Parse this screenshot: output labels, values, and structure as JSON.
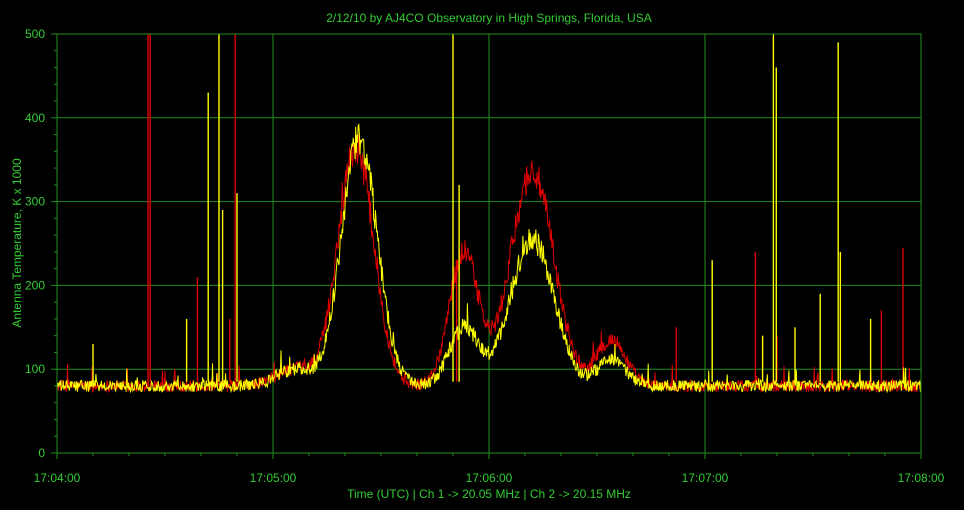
{
  "chart_data": {
    "type": "line",
    "title": "2/12/10  by  AJ4CO Observatory  in  High Springs, Florida, USA",
    "xlabel": "Time (UTC)  |  Ch 1 -> 20.05 MHz  |  Ch 2 -> 20.15 MHz",
    "ylabel": "Antenna Temperature, K x 1000",
    "xlim_seconds": [
      0,
      240
    ],
    "x_tick_labels": [
      "17:04:00",
      "17:05:00",
      "17:06:00",
      "17:07:00",
      "17:08:00"
    ],
    "ylim": [
      0,
      500
    ],
    "y_tick_labels": [
      "0",
      "100",
      "200",
      "300",
      "400",
      "500"
    ],
    "grid": true,
    "baseline": 80,
    "series": [
      {
        "color": "#dd0000",
        "bursts": [
          {
            "center": 83,
            "width": 5,
            "peak": 285
          },
          {
            "center": 113,
            "width": 4,
            "peak": 160
          },
          {
            "center": 132,
            "width": 6,
            "peak": 255
          },
          {
            "center": 154,
            "width": 4,
            "peak": 55
          }
        ],
        "spikes": [
          {
            "t": 25.3,
            "value": 500
          },
          {
            "t": 25.9,
            "value": 500
          },
          {
            "t": 49.5,
            "value": 500
          },
          {
            "t": 39,
            "value": 210
          },
          {
            "t": 48,
            "value": 160
          },
          {
            "t": 111,
            "value": 230
          },
          {
            "t": 172,
            "value": 150
          },
          {
            "t": 194,
            "value": 240
          },
          {
            "t": 200,
            "value": 140
          },
          {
            "t": 229,
            "value": 170
          },
          {
            "t": 235,
            "value": 245
          }
        ]
      },
      {
        "color": "#ffff00",
        "bursts": [
          {
            "center": 84,
            "width": 5,
            "peak": 295
          },
          {
            "center": 113,
            "width": 4,
            "peak": 70
          },
          {
            "center": 132,
            "width": 6,
            "peak": 175
          },
          {
            "center": 154,
            "width": 4,
            "peak": 30
          }
        ],
        "spikes": [
          {
            "t": 10,
            "value": 130
          },
          {
            "t": 36,
            "value": 160
          },
          {
            "t": 42,
            "value": 430
          },
          {
            "t": 45,
            "value": 500
          },
          {
            "t": 46,
            "value": 290
          },
          {
            "t": 50,
            "value": 310
          },
          {
            "t": 110,
            "value": 500
          },
          {
            "t": 111.7,
            "value": 320
          },
          {
            "t": 182,
            "value": 230
          },
          {
            "t": 196,
            "value": 140
          },
          {
            "t": 199,
            "value": 500
          },
          {
            "t": 199.8,
            "value": 460
          },
          {
            "t": 205,
            "value": 150
          },
          {
            "t": 212,
            "value": 190
          },
          {
            "t": 217,
            "value": 490
          },
          {
            "t": 217.6,
            "value": 240
          },
          {
            "t": 226,
            "value": 160
          }
        ]
      }
    ]
  }
}
